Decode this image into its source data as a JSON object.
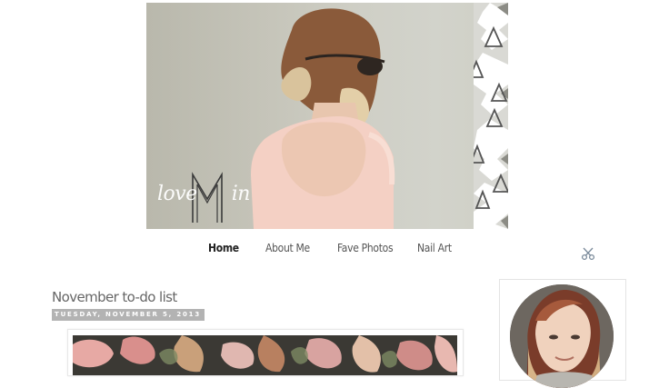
{
  "header": {
    "logo_text": "love Min",
    "logo_word": "love",
    "logo_letter": "M",
    "logo_suffix": "in"
  },
  "nav": {
    "items": [
      {
        "label": "Home",
        "active": true
      },
      {
        "label": "About Me",
        "active": false
      },
      {
        "label": "Fave Photos",
        "active": false
      },
      {
        "label": "Nail Art",
        "active": false
      }
    ]
  },
  "post": {
    "title": "November to-do list",
    "date": "TUESDAY, NOVEMBER 5, 2013"
  },
  "icons": {
    "scissors": "scissors-icon"
  },
  "colors": {
    "date_badge_bg": "#b3b3b3",
    "title_text": "#666666",
    "banner_bg": "#c9c8bd"
  }
}
